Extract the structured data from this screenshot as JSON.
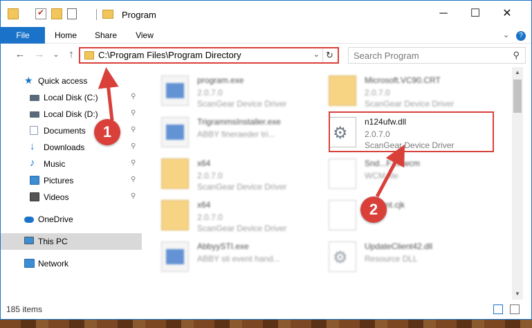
{
  "title_bar": {
    "title": "Program",
    "minimize": "─",
    "maximize": "☐",
    "close": "✕"
  },
  "ribbon": {
    "tabs": [
      "File",
      "Home",
      "Share",
      "View"
    ],
    "expand_icon": "⌄",
    "help_icon": "?"
  },
  "navigation": {
    "back": "←",
    "forward": "→",
    "recent": "⌄",
    "up": "↑",
    "address": "C:\\Program Files\\Program Directory",
    "address_dropdown": "⌄",
    "refresh": "↻",
    "search_placeholder": "Search Program",
    "search_icon": "⚲"
  },
  "sidebar": {
    "items": [
      {
        "label": "Quick access",
        "icon": "star-icon",
        "color": "#1a73c8",
        "pinned": false
      },
      {
        "label": "Local Disk (C:)",
        "icon": "drive-icon",
        "color": "#5a6a7a",
        "pinned": true
      },
      {
        "label": "Local Disk (D:)",
        "icon": "drive-icon",
        "color": "#5a6a7a",
        "pinned": true
      },
      {
        "label": "Documents",
        "icon": "documents-icon",
        "color": "#8a9bb0",
        "pinned": true
      },
      {
        "label": "Downloads",
        "icon": "downloads-icon",
        "color": "#1a73c8",
        "pinned": true
      },
      {
        "label": "Music",
        "icon": "music-icon",
        "color": "#1a73c8",
        "pinned": true
      },
      {
        "label": "Pictures",
        "icon": "pictures-icon",
        "color": "#3b8ed4",
        "pinned": true
      },
      {
        "label": "Videos",
        "icon": "videos-icon",
        "color": "#555555",
        "pinned": true
      },
      {
        "label": "OneDrive",
        "icon": "cloud-icon",
        "color": "#1a73c8",
        "pinned": false
      },
      {
        "label": "This PC",
        "icon": "pc-icon",
        "color": "#3b8ed4",
        "pinned": false,
        "selected": true
      },
      {
        "label": "Network",
        "icon": "network-icon",
        "color": "#3b8ed4",
        "pinned": false
      }
    ],
    "pin_icon": "📌"
  },
  "files": [
    {
      "name": "program.exe",
      "line2": "2.0.7.0",
      "line3": "ScanGear Device Driver",
      "icon": "exe",
      "blurred": true
    },
    {
      "name": "Microsoft.VC90.CRT",
      "line2": "2.0.7.0",
      "line3": "ScanGear Device Driver",
      "icon": "folder",
      "blurred": true
    },
    {
      "name": "TrigrammsInstaller.exe",
      "line2": "ABBY fineraeder tri...",
      "line3": "",
      "icon": "exe",
      "blurred": true
    },
    {
      "name": "n124ufw.dll",
      "line2": "2.0.7.0",
      "line3": "ScanGear Device Driver",
      "icon": "gear",
      "blurred": false
    },
    {
      "name": "x64",
      "line2": "2.0.7.0",
      "line3": "ScanGear Device Driver",
      "icon": "folder",
      "blurred": true
    },
    {
      "name": "Snd...F15.wcm",
      "line2": "WCM file",
      "line3": "",
      "icon": "doc",
      "blurred": true
    },
    {
      "name": "x64",
      "line2": "2.0.7.0",
      "line3": "ScanGear Device Driver",
      "icon": "folder",
      "blurred": true
    },
    {
      "name": "...ltFont.cjk",
      "line2": "",
      "line3": "",
      "icon": "doc",
      "blurred": true
    },
    {
      "name": "AbbyySTI.exe",
      "line2": "ABBY sti event hand...",
      "line3": "",
      "icon": "exe",
      "blurred": true
    },
    {
      "name": "UpdateClient42.dll",
      "line2": "Resource DLL",
      "line3": "",
      "icon": "gear",
      "blurred": true
    }
  ],
  "status": {
    "count": "185 items"
  },
  "scrollbar": {
    "up": "▲",
    "down": "▼"
  },
  "callouts": [
    "1",
    "2"
  ],
  "colors": {
    "accent": "#1a73c8",
    "highlight": "#d9403a"
  }
}
